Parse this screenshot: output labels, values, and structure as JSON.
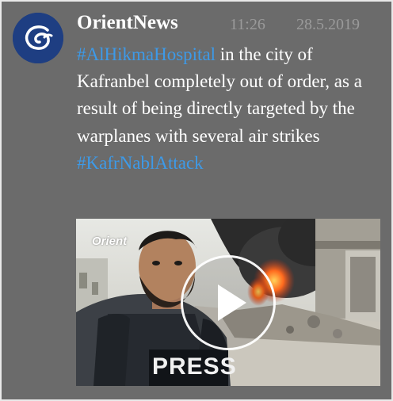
{
  "post": {
    "author": "OrientNews",
    "time": "11:26",
    "date": "28.5.2019",
    "text": {
      "hashtag1": "#AlHikmaHospital",
      "body": " in the city of Kafranbel completely out of order, as a result of being directly targeted by the warplanes with several air strikes ",
      "hashtag2": "#KafrNablAttack"
    }
  },
  "video": {
    "channel_logo": "Orient",
    "vest_label": "PRESS",
    "play_icon": "play-icon"
  },
  "colors": {
    "background": "#6b6b6b",
    "hashtag": "#3d9ae8",
    "avatar": "#1e3e82",
    "meta_text": "#9a9a9a"
  }
}
